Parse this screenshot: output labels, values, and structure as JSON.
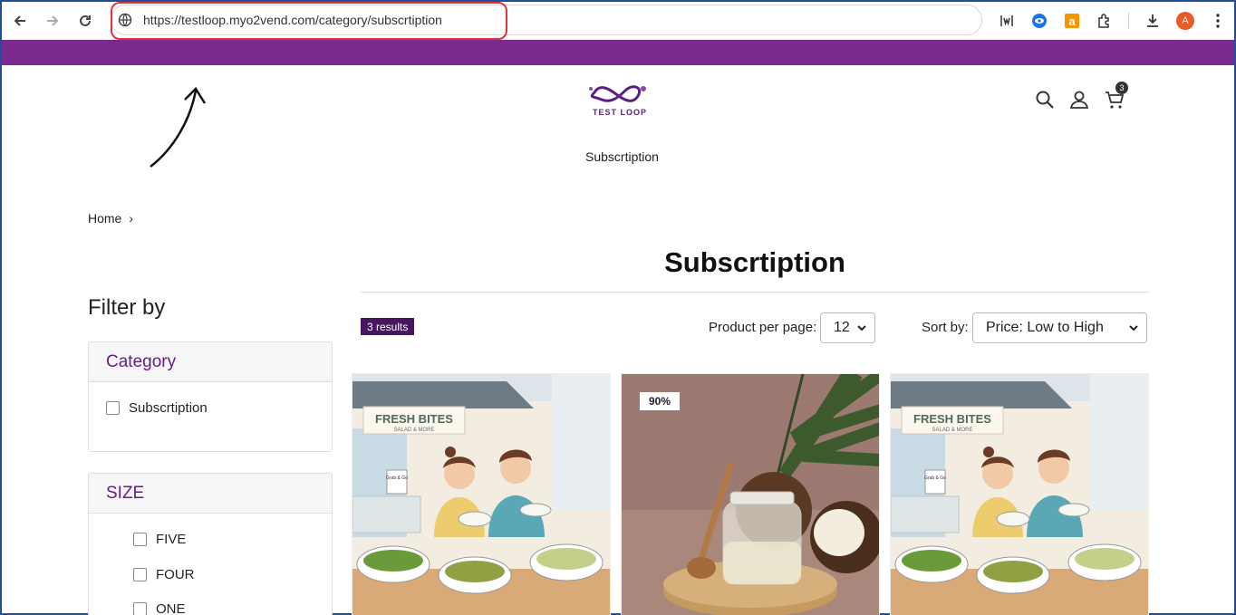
{
  "browser": {
    "url": "https://testloop.myo2vend.com/category/subscrtiption",
    "profile_initial": "A"
  },
  "site": {
    "logo_text": "TEST LOOP",
    "nav_link": "Subscrtiption",
    "cart_count": "3",
    "accent_color": "#7b2b8f"
  },
  "breadcrumb": {
    "home": "Home",
    "separator": "›"
  },
  "page": {
    "title": "Subscrtiption"
  },
  "filters": {
    "title": "Filter by",
    "category": {
      "heading": "Category",
      "options": [
        "Subscrtiption"
      ]
    },
    "size": {
      "heading": "SIZE",
      "options": [
        "FIVE",
        "FOUR",
        "ONE"
      ]
    }
  },
  "toolbar": {
    "results": "3 results",
    "per_page_label": "Product per page:",
    "per_page_value": "12",
    "sort_label": "Sort by:",
    "sort_value": "Price: Low to High"
  },
  "products": [
    {
      "image": "salad-shop-illustration",
      "sign": "FRESH BITES",
      "sign_sub": "SALAD & MORE",
      "menu": "Grab & Go"
    },
    {
      "image": "coconut-oil-jar",
      "discount": "90%"
    },
    {
      "image": "salad-shop-illustration",
      "sign": "FRESH BITES",
      "sign_sub": "SALAD & MORE",
      "menu": "Grab & Go"
    }
  ]
}
